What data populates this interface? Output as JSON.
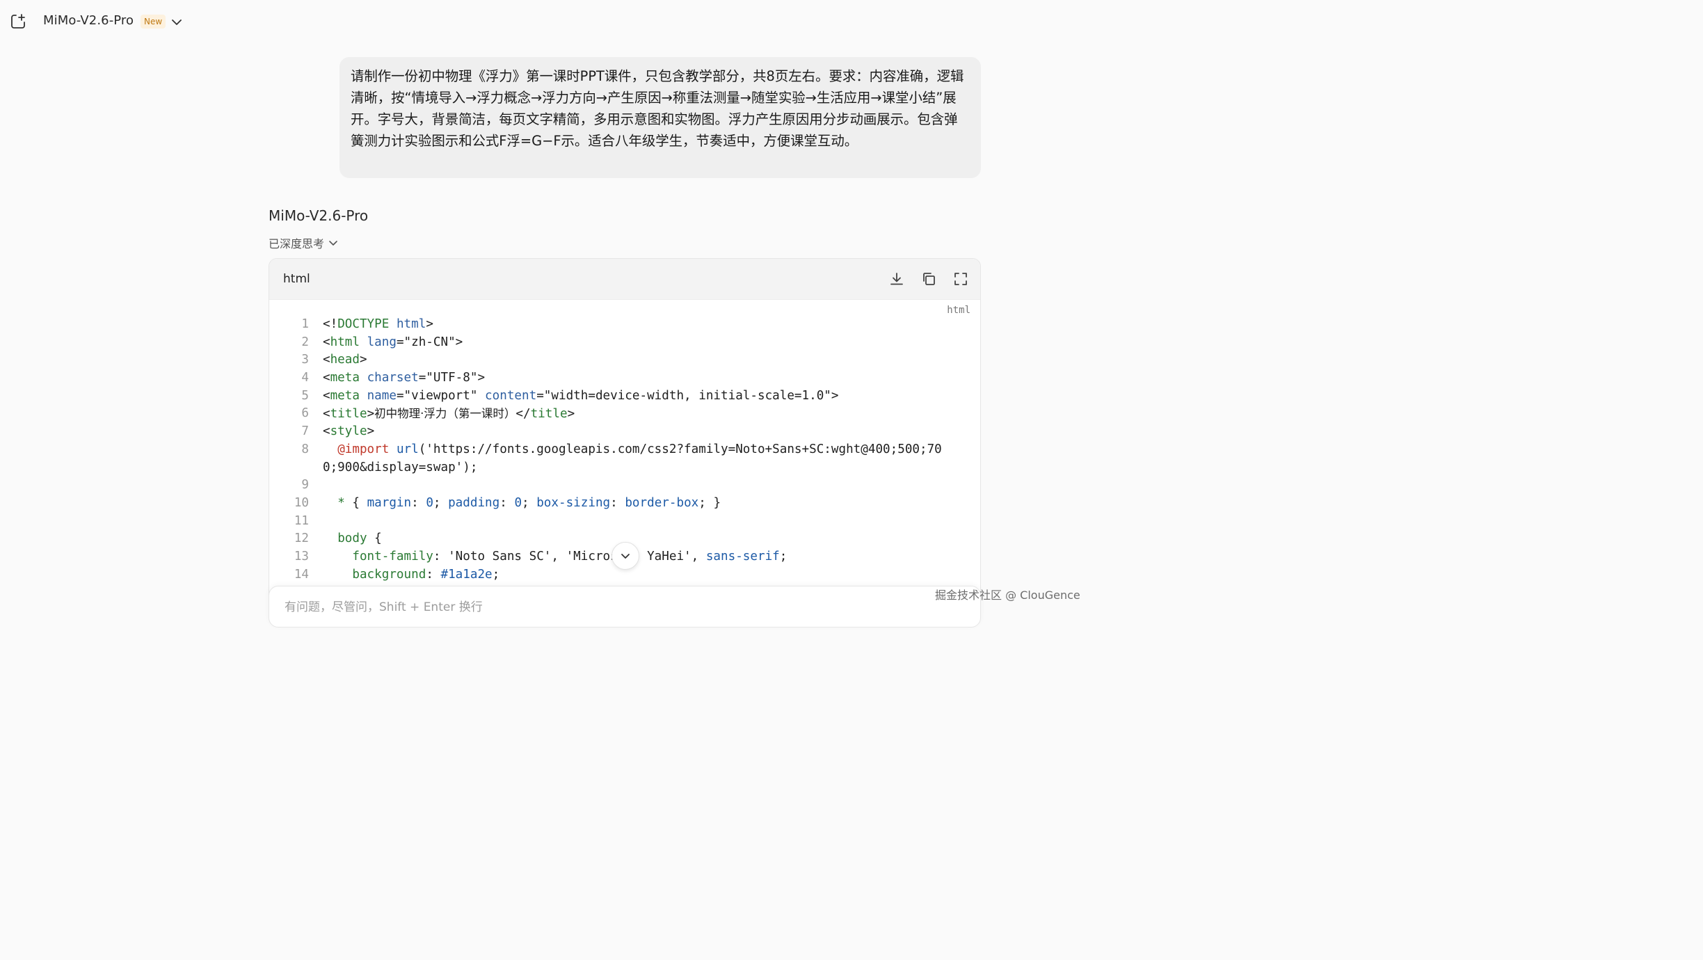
{
  "header": {
    "model_name": "MiMo-V2.6-Pro",
    "badge": "New",
    "icons": [
      "new-chat-icon",
      "chevron-down-icon"
    ]
  },
  "user_message": {
    "text": "请制作一份初中物理《浮力》第一课时PPT课件，只包含教学部分，共8页左右。要求：内容准确，逻辑清晰，按“情境导入→浮力概念→浮力方向→产生原因→称重法测量→随堂实验→生活应用→课堂小结”展开。字号大，背景简洁，每页文字精简，多用示意图和实物图。浮力产生原因用分步动画展示。包含弹簧测力计实验图示和公式F浮=G−F示。适合八年级学生，节奏适中，方便课堂互动。"
  },
  "reply": {
    "model_name": "MiMo-V2.6-Pro",
    "thinking_label": "已深度思考"
  },
  "code_block": {
    "language": "html",
    "corner_label": "html",
    "actions": [
      "download-icon",
      "copy-icon",
      "fullscreen-icon"
    ],
    "lines": [
      {
        "n": "1",
        "parts": [
          [
            "t",
            "<!"
          ],
          [
            "tag",
            "DOCTYPE"
          ],
          [
            "t",
            " "
          ],
          [
            "attr",
            "html"
          ],
          [
            "t",
            ">"
          ]
        ]
      },
      {
        "n": "2",
        "parts": [
          [
            "t",
            "<"
          ],
          [
            "tag",
            "html"
          ],
          [
            "t",
            " "
          ],
          [
            "attr",
            "lang"
          ],
          [
            "t",
            "=\"zh-CN\">"
          ]
        ]
      },
      {
        "n": "3",
        "parts": [
          [
            "t",
            "<"
          ],
          [
            "tag",
            "head"
          ],
          [
            "t",
            ">"
          ]
        ]
      },
      {
        "n": "4",
        "parts": [
          [
            "t",
            "<"
          ],
          [
            "tag",
            "meta"
          ],
          [
            "t",
            " "
          ],
          [
            "attr",
            "charset"
          ],
          [
            "t",
            "=\"UTF-8\">"
          ]
        ]
      },
      {
        "n": "5",
        "parts": [
          [
            "t",
            "<"
          ],
          [
            "tag",
            "meta"
          ],
          [
            "t",
            " "
          ],
          [
            "attr",
            "name"
          ],
          [
            "t",
            "=\"viewport\" "
          ],
          [
            "attr",
            "content"
          ],
          [
            "t",
            "=\"width=device-width, initial-scale=1.0\">"
          ]
        ]
      },
      {
        "n": "6",
        "parts": [
          [
            "t",
            "<"
          ],
          [
            "tag",
            "title"
          ],
          [
            "t",
            ">"
          ],
          [
            "cjk",
            "初中物理·浮力（第一课时）"
          ],
          [
            "t",
            "</"
          ],
          [
            "tag",
            "title"
          ],
          [
            "t",
            ">"
          ]
        ]
      },
      {
        "n": "7",
        "parts": [
          [
            "t",
            "<"
          ],
          [
            "tag",
            "style"
          ],
          [
            "t",
            ">"
          ]
        ]
      },
      {
        "n": "8",
        "parts": [
          [
            "t",
            "  "
          ],
          [
            "kw",
            "@import"
          ],
          [
            "t",
            " "
          ],
          [
            "prop",
            "url"
          ],
          [
            "t",
            "('https://fonts.googleapis.com/css2?family=Noto+Sans+SC:wght@400;500;70"
          ]
        ]
      },
      {
        "n": "",
        "parts": [
          [
            "t",
            "0;900&display=swap');"
          ]
        ]
      },
      {
        "n": "9",
        "parts": []
      },
      {
        "n": "10",
        "parts": [
          [
            "t",
            "  "
          ],
          [
            "sel",
            "*"
          ],
          [
            "t",
            " { "
          ],
          [
            "prop",
            "margin"
          ],
          [
            "t",
            ": "
          ],
          [
            "num",
            "0"
          ],
          [
            "t",
            "; "
          ],
          [
            "prop",
            "padding"
          ],
          [
            "t",
            ": "
          ],
          [
            "num",
            "0"
          ],
          [
            "t",
            "; "
          ],
          [
            "prop",
            "box-sizing"
          ],
          [
            "t",
            ": "
          ],
          [
            "prop",
            "border-box"
          ],
          [
            "t",
            "; }"
          ]
        ]
      },
      {
        "n": "11",
        "parts": []
      },
      {
        "n": "12",
        "parts": [
          [
            "t",
            "  "
          ],
          [
            "sel",
            "body"
          ],
          [
            "t",
            " {"
          ]
        ]
      },
      {
        "n": "13",
        "parts": [
          [
            "t",
            "    "
          ],
          [
            "sel",
            "font-family"
          ],
          [
            "t",
            ": 'Noto Sans SC', 'Microsoft YaHei', "
          ],
          [
            "prop",
            "sans-serif"
          ],
          [
            "t",
            ";"
          ]
        ]
      },
      {
        "n": "14",
        "parts": [
          [
            "t",
            "    "
          ],
          [
            "sel",
            "background"
          ],
          [
            "t",
            ": "
          ],
          [
            "prop",
            "#1a1a2e"
          ],
          [
            "t",
            ";"
          ]
        ]
      }
    ]
  },
  "composer": {
    "placeholder": "有问题，尽管问，Shift + Enter 换行"
  },
  "watermark": "掘金技术社区 @ ClouGence"
}
